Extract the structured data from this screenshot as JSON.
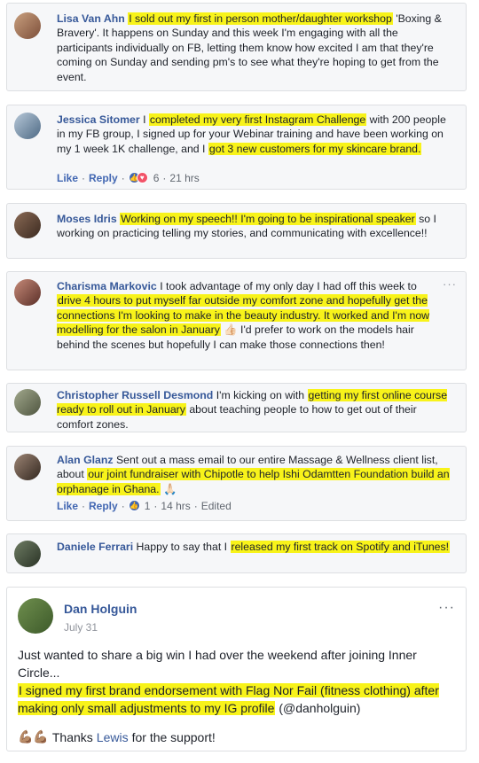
{
  "comments": [
    {
      "name": "Lisa Van Ahn",
      "hl": "I sold out my first in person mother/daughter workshop",
      "rest": " 'Boxing & Bravery'. It happens on Sunday and this week I'm engaging with all the participants individually on FB, letting them know how excited I am that they're coming on Sunday and sending pm's to see what they're hoping to get from the event."
    },
    {
      "name": "Jessica Sitomer",
      "pre": " I ",
      "hl1": "completed my very first Instagram Challenge",
      "mid": " with 200 people in my FB group, I signed up for your Webinar training and have been working on my 1 week 1K challenge, and I ",
      "hl2": "got 3 new customers for my skincare brand.",
      "like": "Like",
      "reply": "Reply",
      "count": "6",
      "time": "21 hrs"
    },
    {
      "name": "Moses Idris",
      "hl": "Working on my speech!! I'm going to be inspirational speaker",
      "rest": " so I working on practicing telling my stories, and communicating with excellence!!"
    },
    {
      "name": "Charisma Markovic",
      "pre": " I took advantage of my only day I had off this week to ",
      "hl1": "drive 4 hours to put myself far outside my comfort zone and hopefully get the connections I'm looking to make in the beauty industry. It worked and I'm now modelling for the salon in January",
      "emoji": "👍🏻",
      "rest": " I'd prefer to work on the models hair behind the scenes but hopefully I can make those connections then!",
      "more": "···"
    },
    {
      "name": "Christopher Russell Desmond",
      "pre": " I'm kicking on with ",
      "hl1": "getting my first online course ready to roll out in January",
      "rest": " about teaching people to how to get out of their comfort zones."
    },
    {
      "name": "Alan Glanz",
      "pre": " Sent out a mass email to our entire Massage & Wellness client list, about ",
      "hl1": "our joint fundraiser with Chipotle to help Ishi Odamtten Foundation build an orphanage in Ghana.",
      "emoji": "🙏🏻",
      "like": "Like",
      "reply": "Reply",
      "count": "1",
      "time": "14 hrs",
      "edited": "Edited"
    },
    {
      "name": "Daniele Ferrari",
      "pre": " Happy to say that I ",
      "hl1": "released my first track on Spotify and iTunes!"
    }
  ],
  "post": {
    "name": "Dan Holguin",
    "date": "July 31",
    "more": "···",
    "line1": "Just wanted to share a big win I had over the weekend after joining Inner Circle...",
    "hl": "I signed my first brand endorsement with Flag Nor Fail (fitness clothing) after making only small adjustments to my IG profile",
    "handle": " (@danholguin)",
    "emoji": "💪🏽💪🏽",
    "thanks": "Thanks",
    "lewis": "Lewis",
    "support": "for the support!"
  }
}
